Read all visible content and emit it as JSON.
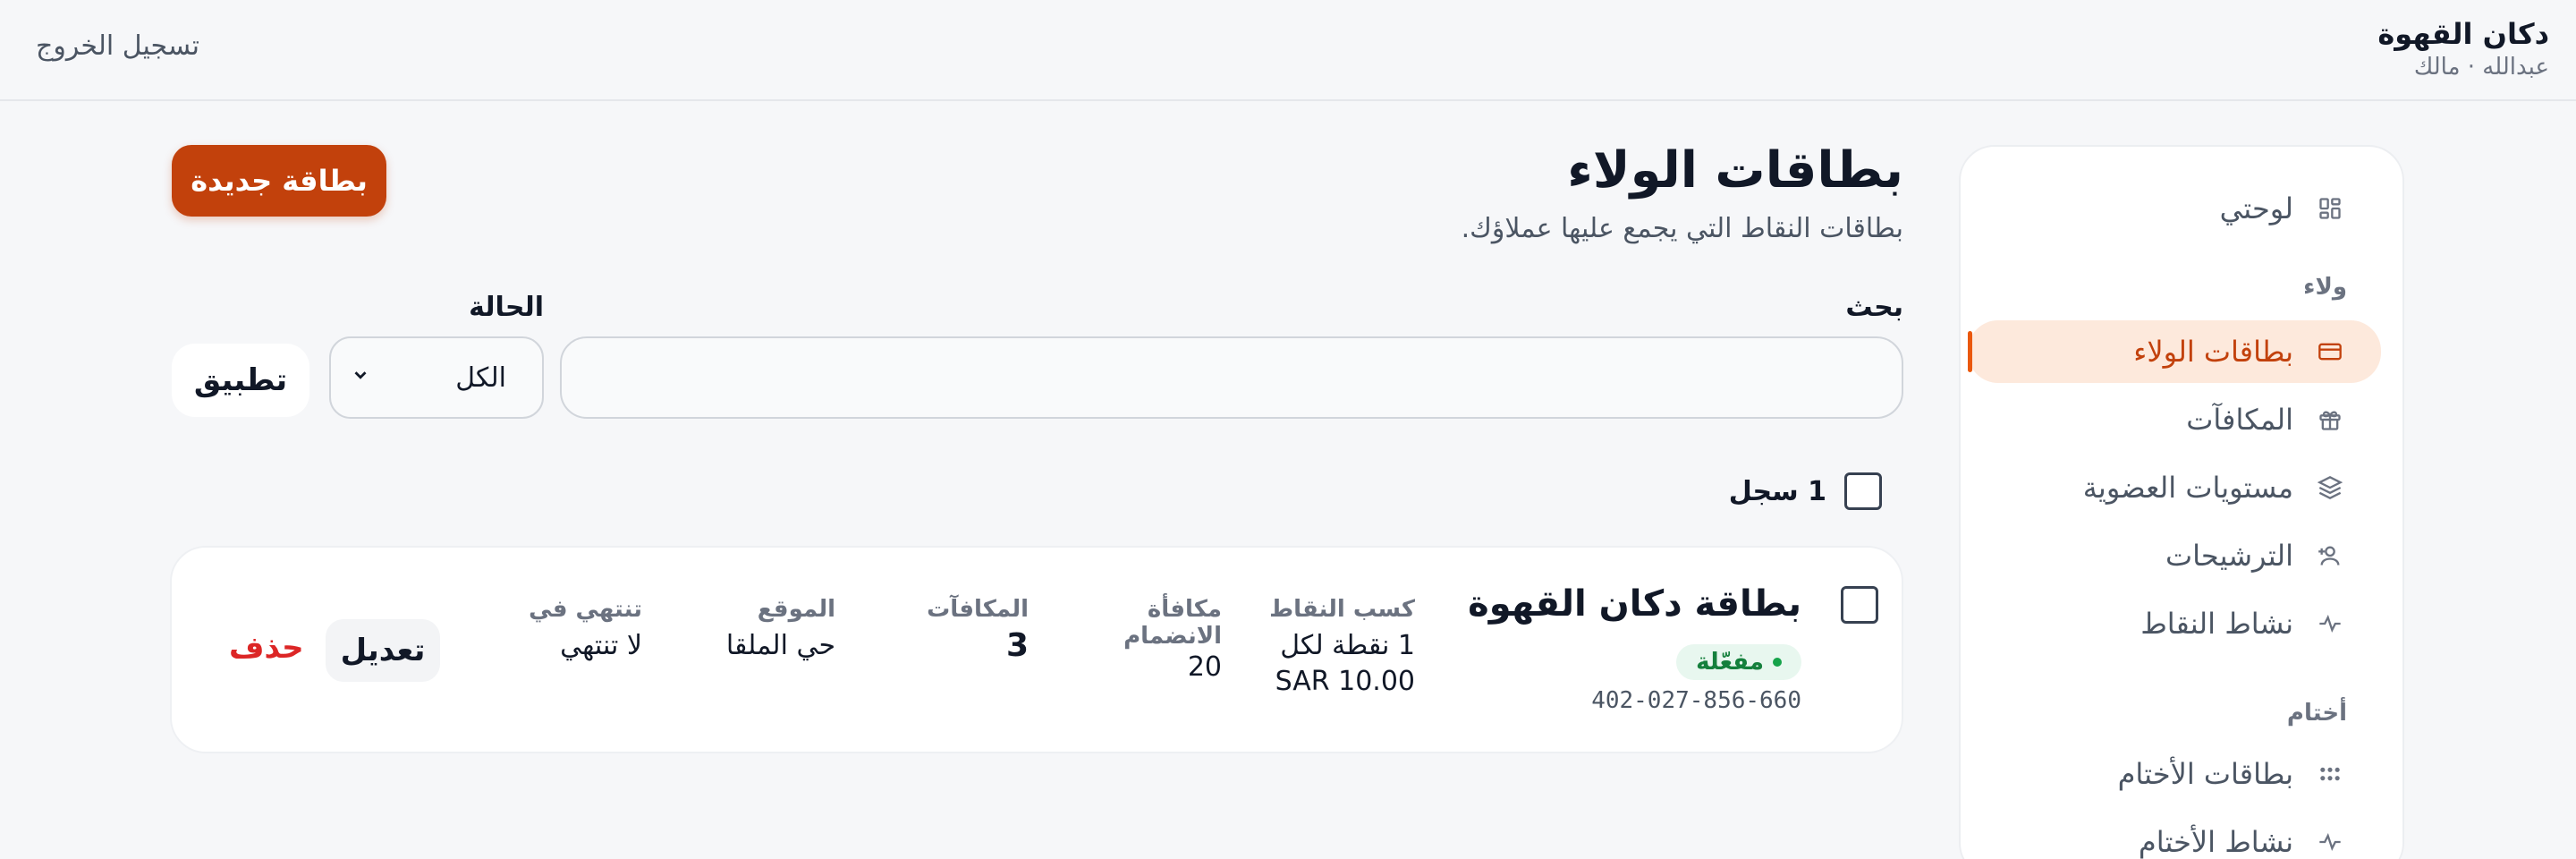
{
  "header": {
    "brand": "دكان القهوة",
    "user": "عبدالله · مالك",
    "logout": "تسجيل الخروج"
  },
  "sidebar": {
    "dashboard": "لوحتي",
    "section_loyalty": "ولاء",
    "loyalty_cards": "بطاقات الولاء",
    "rewards": "المكافآت",
    "tiers": "مستويات العضوية",
    "referrals": "الترشيحات",
    "points_activity": "نشاط النقاط",
    "section_stamps": "أختام",
    "stamp_cards": "بطاقات الأختام",
    "stamp_activity": "نشاط الأختام"
  },
  "page": {
    "title": "بطاقات الولاء",
    "subtitle": "بطاقات النقاط التي يجمع عليها عملاؤك.",
    "new_button": "بطاقة جديدة"
  },
  "filters": {
    "search_label": "بحث",
    "search_value": "",
    "status_label": "الحالة",
    "status_value": "الكل",
    "apply_button": "تطبيق"
  },
  "list": {
    "count": "1 سجل"
  },
  "card": {
    "name": "بطاقة دكان القهوة",
    "status": "مفعّلة",
    "code": "402-027-856-660",
    "earn_label": "كسب النقاط",
    "earn_value_1": "1 نقطة لكل",
    "earn_value_2": "SAR 10.00",
    "join_label_1": "مكافأة",
    "join_label_2": "الانضمام",
    "join_value": "20",
    "rewards_label": "المكافآت",
    "rewards_value": "3",
    "location_label": "الموقع",
    "location_value": "حي الملقا",
    "expires_label": "تنتهي في",
    "expires_value": "لا تنتهي",
    "edit_button": "تعديل",
    "delete_button": "حذف"
  },
  "colors": {
    "accent": "#c2410c",
    "active_bg": "#fde9dc",
    "success": "#15803d",
    "danger": "#dc2626"
  }
}
